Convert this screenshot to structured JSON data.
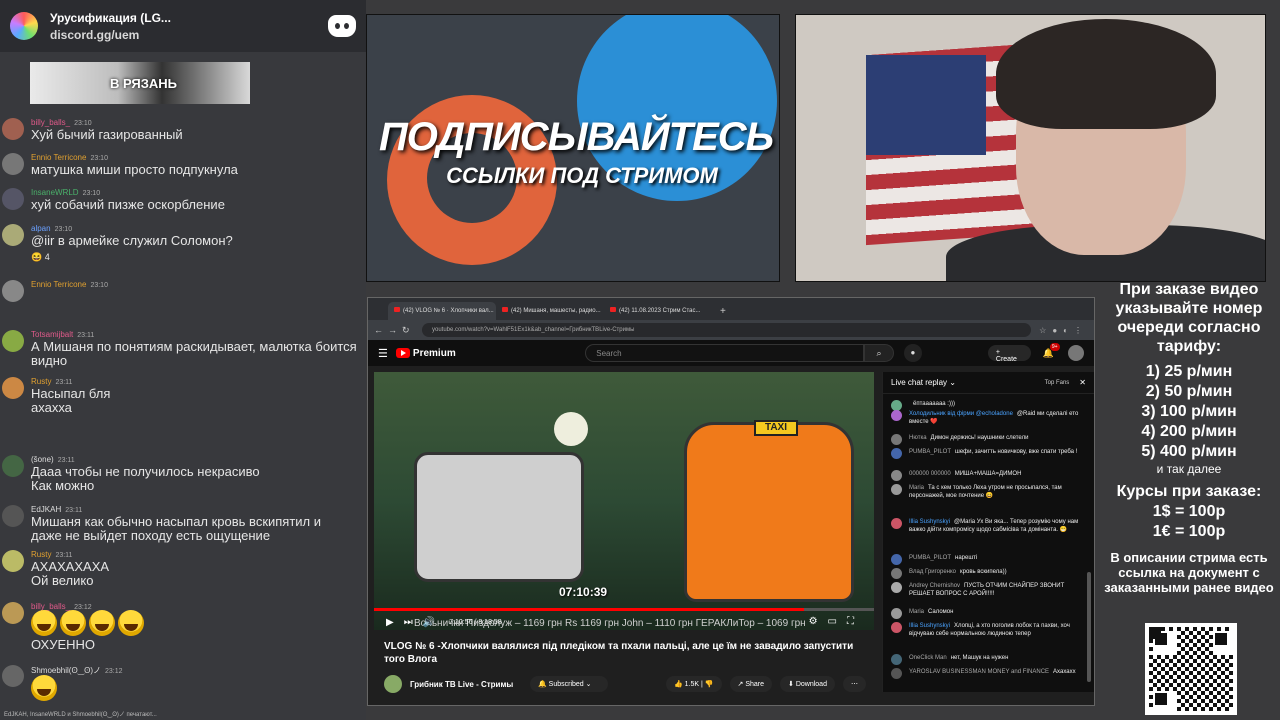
{
  "discord": {
    "server_name": "Урусификация (LG...",
    "invite": "discord.gg/uem",
    "sticker_caption": "В РЯЗАНЬ",
    "typing": "EdJKAH, InsaneWRLD и Shmoebhil(ʘ‿ʘ)ノ печатают...",
    "messages": [
      {
        "user": "billy_balls_",
        "time": "23:10",
        "color": "#e05a8a",
        "text": "Хуй бычий газированный"
      },
      {
        "user": "Ennio Terricone",
        "time": "23:10",
        "color": "#e0a030",
        "text": "матушка миши просто подпукнула"
      },
      {
        "user": "InsaneWRLD",
        "time": "23:10",
        "color": "#4ab06a",
        "text": "хуй собачий пизже оскорбление"
      },
      {
        "user": "alpan",
        "time": "23:10",
        "color": "#6aa0ff",
        "text": "@iir в армейке служил Соломон?",
        "reaction": "4"
      },
      {
        "user": "Ennio Terricone",
        "time": "23:10",
        "color": "#e0a030",
        "text": ""
      },
      {
        "user": "Totsamijbalt",
        "time": "23:11",
        "color": "#e05a8a",
        "text": "А Мишаня по понятиям раскидывает, малютка боится",
        "text2": "видно"
      },
      {
        "user": "Rusty",
        "time": "23:11",
        "color": "#e0a030",
        "text": "Насыпал бля",
        "text2": "ахахха"
      },
      {
        "user": "(šone)",
        "time": "23:11",
        "color": "#dddddd",
        "text": "Дааа чтобы не получилось некрасиво",
        "text2": "Как можно"
      },
      {
        "user": "EdJKAH",
        "time": "23:11",
        "color": "#dddddd",
        "text": "Мишаня как обычно насыпал кровь вскипятил и",
        "text2": "даже не выйдет походу есть ощущение"
      },
      {
        "user": "Rusty",
        "time": "23:11",
        "color": "#e0a030",
        "text": "АХАХАХАХА",
        "text2": "Ой велико"
      },
      {
        "user": "billy_balls_",
        "time": "23:12",
        "color": "#e05a8a",
        "text": "ОХУЕННО"
      },
      {
        "user": "Shmoebhil(ʘ‿ʘ)ノ",
        "time": "23:12",
        "color": "#dddddd",
        "text": ""
      }
    ]
  },
  "banner": {
    "title": "ПОДПИСЫВАЙТЕСЬ",
    "subtitle": "ССЫЛКИ ПОД СТРИМОМ"
  },
  "browser": {
    "tabs": [
      "(42) VLOG № 6 · Хлопчики вал...",
      "(42) Мишаня, машесты, радио...",
      "(42) 11.08.2023 Стрим Стас..."
    ],
    "url": "youtube.com/watch?v=WahlF51Ex1k&ab_channel=ГрибникТВLive-Стримы",
    "yt_brand": "Premium",
    "search_placeholder": "Search",
    "create_label": "Create",
    "notif_count": "9+",
    "video_overlay_time": "07:10:39",
    "ticker": "Вольнички Пиздолуж – 1169 грн     Rs  1169 грн     John – 1110 грн     ГЕРАКЛиТор – 1069 грн",
    "player_time": "7:10:56 / 8:18:58",
    "progress": 0.86,
    "video_title": "VLOG № 6 -Хлопчики валялися під пледіком та пхали пальці, але це їм не завадило запустити того Влога",
    "channel": "Грибник ТВ Live - Стримы",
    "subscribed_label": "Subscribed",
    "likes": "1.5K",
    "share_label": "Share",
    "download_label": "Download"
  },
  "livechat": {
    "header": "Live chat replay",
    "top_fans": "Top Fans",
    "messages": [
      {
        "author": "",
        "text": "ёптааааааа :)))"
      },
      {
        "author": "Холодильник від фірми @echoladone",
        "member": true,
        "text": "@Raid ми сделалі ето вместе ❤️"
      },
      {
        "author": "Нютка",
        "text": "Димон держись! наушники слетели"
      },
      {
        "author": "PUMBA_PILOT",
        "text": "шефи, зачитть новичкову, вже спати треба !"
      },
      {
        "author": "000000 000000",
        "text": "МИША+МАША=ДИМОН"
      },
      {
        "author": "Maria",
        "text": "Та с кем только Леха утром не просыпался, там персонажей, мое почтение 😄"
      },
      {
        "author": "Illia Sushynskyi",
        "member": true,
        "text": "@Maria Ух Ви яка... Тепер розумію чому нам важко дійти компромісу щодо сабмісіва та домінанта. 😁"
      },
      {
        "author": "PUMBA_PILOT",
        "text": "нарешті"
      },
      {
        "author": "Влад Григоренко",
        "text": "кровь вскипела))"
      },
      {
        "author": "Andrey Chernishov",
        "text": "ПУСТЬ ОТЧИМ СНАЙПЕР ЗВОНИТ РЕШАЕТ ВОПРОС С АРОЙ!!!!!"
      },
      {
        "author": "Maria",
        "text": "Саломон"
      },
      {
        "author": "Illia Sushynskyi",
        "member": true,
        "text": "Хлопці, а хто поголив лобок та пахви, хоч відчуваю себе нормальною людиною тепер"
      },
      {
        "author": "OneClick Man",
        "text": "нет, Машук на нужен"
      },
      {
        "author": "YAROSLAV BUSINESSMAN MONEY and FINANCE",
        "text": "Ахахахх"
      }
    ]
  },
  "info": {
    "order_text": "При заказе видео указывайте номер очереди согласно тарифу:",
    "rates": [
      "1) 25 р/мин",
      "2) 50 р/мин",
      "3) 100 р/мин",
      "4) 200 р/мин",
      "5) 400 р/мин"
    ],
    "and_more": "и так далее",
    "courses_title": "Курсы при заказе:",
    "course1": "1$ = 100р",
    "course2": "1€ = 100р",
    "description_note": "В описании стрима есть ссылка на документ с заказанными ранее видео"
  }
}
